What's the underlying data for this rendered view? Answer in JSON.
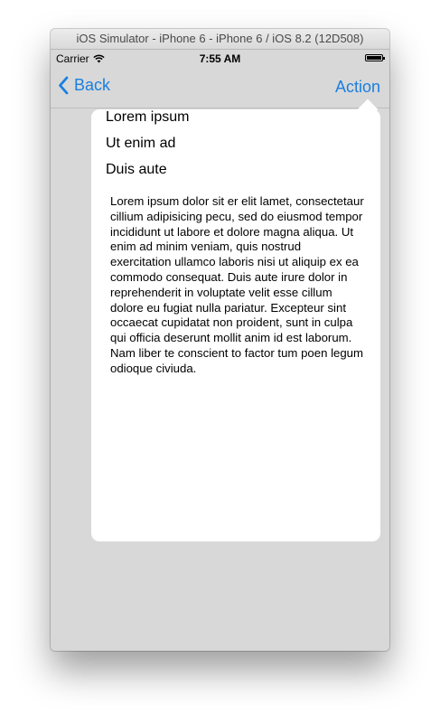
{
  "window": {
    "title": "iOS Simulator - iPhone 6 - iPhone 6 / iOS 8.2 (12D508)"
  },
  "status_bar": {
    "carrier": "Carrier",
    "time": "7:55 AM",
    "wifi_icon": "wifi-icon",
    "battery_icon": "battery-icon"
  },
  "nav_bar": {
    "back_label": "Back",
    "action_label": "Action",
    "accent_color": "#1a7fe0"
  },
  "popover": {
    "items": [
      {
        "label": "Lorem ipsum"
      },
      {
        "label": "Ut enim ad"
      },
      {
        "label": "Duis aute"
      }
    ],
    "body_text": "Lorem ipsum dolor sit er elit lamet, consectetaur cillium adipisicing pecu, sed do eiusmod tempor incididunt ut labore et dolore magna aliqua. Ut enim ad minim veniam, quis nostrud exercitation ullamco laboris nisi ut aliquip ex ea commodo consequat. Duis aute irure dolor in reprehenderit in voluptate velit esse cillum dolore eu fugiat nulla pariatur. Excepteur sint occaecat cupidatat non proident, sunt in culpa qui officia deserunt mollit anim id est laborum. Nam liber te conscient to factor tum poen legum odioque civiuda."
  }
}
